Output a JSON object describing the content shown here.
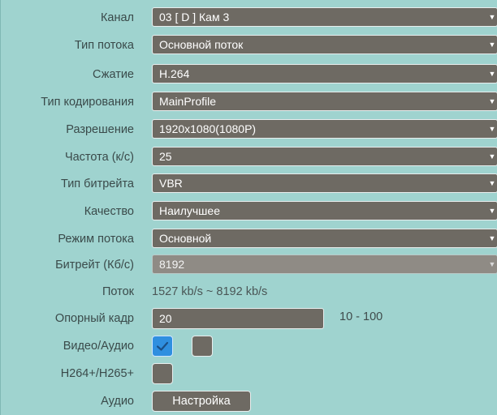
{
  "fields": {
    "channel": {
      "label": "Канал",
      "value": "03 [ D ] Кам 3"
    },
    "stream_type": {
      "label": "Тип потока",
      "value": "Основной поток"
    },
    "compression": {
      "label": "Сжатие",
      "value": "H.264"
    },
    "encoding_type": {
      "label": "Тип кодирования",
      "value": "MainProfile"
    },
    "resolution": {
      "label": "Разрешение",
      "value": "1920x1080(1080P)"
    },
    "frame_rate": {
      "label": "Частота (к/с)",
      "value": "25"
    },
    "bitrate_type": {
      "label": "Тип битрейта",
      "value": "VBR"
    },
    "quality": {
      "label": "Качество",
      "value": "Наилучшее"
    },
    "stream_mode": {
      "label": "Режим потока",
      "value": "Основной"
    },
    "bitrate": {
      "label": "Битрейт (Кб/с)",
      "value": "8192"
    },
    "stream": {
      "label": "Поток",
      "value": "1527 kb/s ~ 8192 kb/s"
    },
    "keyframe": {
      "label": "Опорный кадр",
      "value": "20",
      "range": "10 - 100"
    },
    "video_audio": {
      "label": "Видео/Аудио",
      "video_checked": true,
      "audio_checked": false
    },
    "h264plus": {
      "label": "H264+/H265+",
      "checked": false
    },
    "audio": {
      "label": "Аудио",
      "button_label": "Настройка"
    }
  },
  "colors": {
    "background": "#9fd3cf",
    "control": "#6e6a63",
    "checked": "#2f8fe0"
  }
}
